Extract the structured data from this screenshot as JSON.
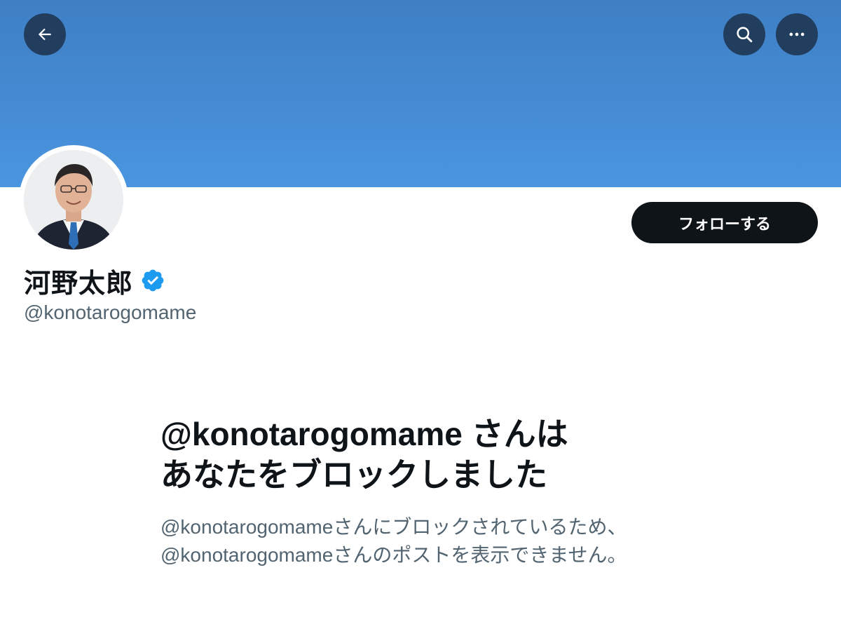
{
  "header": {
    "back_icon": "arrow-left-icon",
    "search_icon": "search-icon",
    "more_icon": "more-horizontal-icon",
    "banner_color": "#4a95e0",
    "button_bg": "#213e5f"
  },
  "profile": {
    "display_name": "河野太郎",
    "verified_icon": "verified-badge-icon",
    "verified_color": "#1d9bf0",
    "handle": "@konotarogomame",
    "follow_label": "フォローする"
  },
  "blocked": {
    "title_line1": "@konotarogomame さんは",
    "title_line2": "あなたをブロックしました",
    "desc_line1": "@konotarogomameさんにブロックされているため、",
    "desc_line2": "@konotarogomameさんのポストを表示できません。"
  }
}
